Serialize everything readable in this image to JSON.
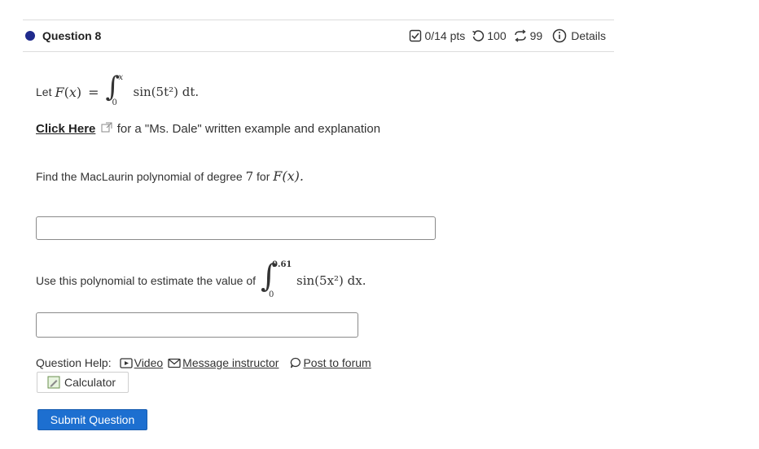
{
  "question": {
    "title": "Question 8",
    "score": "0/14 pts",
    "attempts": "100",
    "retries": "99",
    "details_label": "Details"
  },
  "problem": {
    "let_label": "Let",
    "F": "F",
    "x": "x",
    "t": "t",
    "eq": "=",
    "upper_limit": "x",
    "lower_limit": "0",
    "integrand": "sin(5t²) dt.",
    "click_here": "Click Here",
    "link_text": "for a \"Ms. Dale\" written example and explanation",
    "find_prefix": "Find the MacLaurin polynomial of degree",
    "degree": "7",
    "find_for": "for",
    "find_suffix": "F(x).",
    "estimate_prefix": "Use this polynomial to estimate the value of",
    "estimate_upper": "0.61",
    "estimate_lower": "0",
    "estimate_integrand": "sin(5x²) dx."
  },
  "help": {
    "label": "Question Help:",
    "video": "Video",
    "message": "Message instructor",
    "forum": "Post to forum",
    "calculator": "Calculator"
  },
  "submit_label": "Submit Question"
}
